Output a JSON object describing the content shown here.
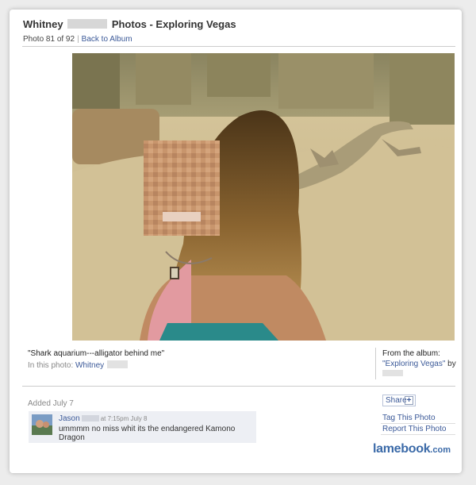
{
  "header": {
    "title_prefix": "Whitney",
    "title_suffix": "Photos - Exploring Vegas",
    "photo_count": "Photo 81 of 92",
    "back_link": "Back to Album"
  },
  "photo": {
    "alt": "Woman in front of komodo dragon enclosure"
  },
  "caption": {
    "text": "\"Shark aquarium---alligator behind me\"",
    "in_photo_label": "In this photo:",
    "in_photo_name": "Whitney"
  },
  "album": {
    "from_label": "From the album:",
    "album_name": "\"Exploring Vegas\"",
    "by_label": "by"
  },
  "meta": {
    "added": "Added July 7"
  },
  "comment": {
    "author": "Jason",
    "time": "at 7:15pm July 8",
    "text": "ummmm no miss whit its the endangered Kamono Dragon"
  },
  "actions": {
    "share_label": "Share",
    "share_plus": "+",
    "tag_label": "Tag This Photo",
    "report_label": "Report This Photo"
  },
  "watermark": {
    "brand": "lamebook",
    "tld": ".com"
  },
  "colors": {
    "link": "#3b5998",
    "comment_bg": "#edeff4",
    "watermark": "#3b6aa8"
  }
}
